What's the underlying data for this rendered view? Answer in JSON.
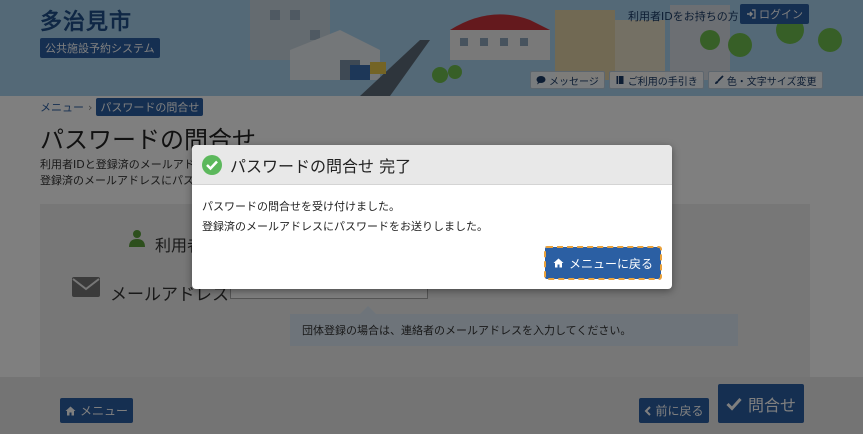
{
  "header": {
    "city_name": "多治見市",
    "system_name": "公共施設予約システム",
    "user_id_text": "利用者IDをお持ちの方",
    "login_label": "ログイン",
    "links": [
      {
        "label": "メッセージ",
        "icon": "speech-bubble-icon"
      },
      {
        "label": "ご利用の手引き",
        "icon": "book-icon"
      },
      {
        "label": "色・文字サイズ変更",
        "icon": "brush-icon"
      }
    ]
  },
  "breadcrumb": {
    "menu": "メニュー",
    "separator": "›",
    "current": "パスワードの問合せ"
  },
  "page": {
    "title": "パスワードの問合せ",
    "desc_line1": "利用者IDと登録済のメールアドレ",
    "desc_line2": "登録済のメールアドレスにパスワ"
  },
  "form": {
    "user_label": "利用者",
    "mail_label": "メールアドレス",
    "mail_value": "",
    "hint": "団体登録の場合は、連絡者のメールアドレスを入力してください。"
  },
  "footer": {
    "menu_label": "メニュー",
    "back_label": "前に戻る",
    "submit_label": "問合せ"
  },
  "modal": {
    "title": "パスワードの問合せ 完了",
    "line1": "パスワードの問合せを受け付けました。",
    "line2": "登録済のメールアドレスにパスワードをお送りしました。",
    "button_label": "メニューに戻る"
  },
  "colors": {
    "primary": "#2b5fa3",
    "success": "#5cb85c",
    "focus_outline": "#e9a13b"
  }
}
